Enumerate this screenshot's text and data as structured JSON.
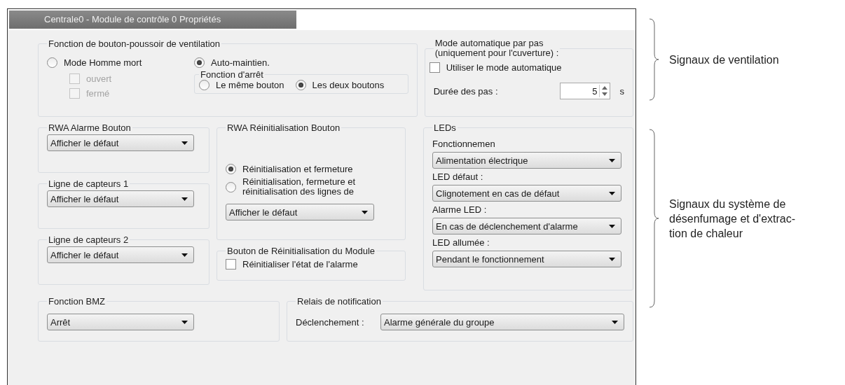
{
  "window": {
    "title": "Centrale0 - Module de contrôle 0 Propriétés"
  },
  "ventilation_button": {
    "title": "Fonction de bouton-poussoir de ventilation",
    "modes": [
      {
        "label": "Mode Homme mort",
        "selected": false
      },
      {
        "label": "Auto-maintien.",
        "selected": true
      }
    ],
    "options": [
      {
        "label": "ouvert",
        "checked": false,
        "disabled": true
      },
      {
        "label": "fermé",
        "checked": false,
        "disabled": true
      }
    ],
    "stop_function": {
      "title": "Fonction d'arrêt",
      "options": [
        {
          "label": "Le même bouton",
          "selected": false
        },
        {
          "label": "Les deux boutons",
          "selected": true
        }
      ]
    }
  },
  "step_mode": {
    "title": "Mode automatique par pas\n(uniquement pour l'cuverture) :",
    "use_auto": {
      "label": "Utiliser le mode automatique",
      "checked": false
    },
    "duration_label": "Durée des pas :",
    "duration_value": "5",
    "unit": "s"
  },
  "left_groups": [
    {
      "title": "RWA Alarme Bouton",
      "value": "Afficher le défaut"
    },
    {
      "title": "Ligne de capteurs 1",
      "value": "Afficher le défaut"
    },
    {
      "title": "Ligne de capteurs 2",
      "value": "Afficher le défaut"
    }
  ],
  "rwa_reset": {
    "title": "RWA Réinitialisation Bouton",
    "options": [
      {
        "label": "Réinitialisation et fermeture",
        "selected": true
      },
      {
        "label": "Réinitialisation, fermeture et\nréinitialisation des lignes de",
        "selected": false
      }
    ],
    "value": "Afficher le défaut"
  },
  "module_reset": {
    "title": "Bouton de Réinitialisation du Module",
    "checkbox": {
      "label": "Réinitialiser l'état de l'alarme",
      "checked": false
    }
  },
  "leds": {
    "title": "LEDs",
    "fields": [
      {
        "label": "Fonctionnemen",
        "value": "Alimentation électrique"
      },
      {
        "label": "LED défaut :",
        "value": "Clignotement en cas de défaut"
      },
      {
        "label": "Alarme LED :",
        "value": "En cas de déclenchement d'alarme"
      },
      {
        "label": "LED allumée :",
        "value": "Pendant le fonctionnement"
      }
    ]
  },
  "bmz": {
    "title": "Fonction BMZ",
    "value": "Arrêt"
  },
  "relay": {
    "title": "Relais de notification",
    "label": "Déclenchement :",
    "value": "Alarme générale du groupe"
  },
  "annotations": [
    {
      "text": "Signaux de ventilation"
    },
    {
      "text": "Signaux du système de\ndésenfumage et d'extrac-\ntion de chaleur"
    }
  ]
}
